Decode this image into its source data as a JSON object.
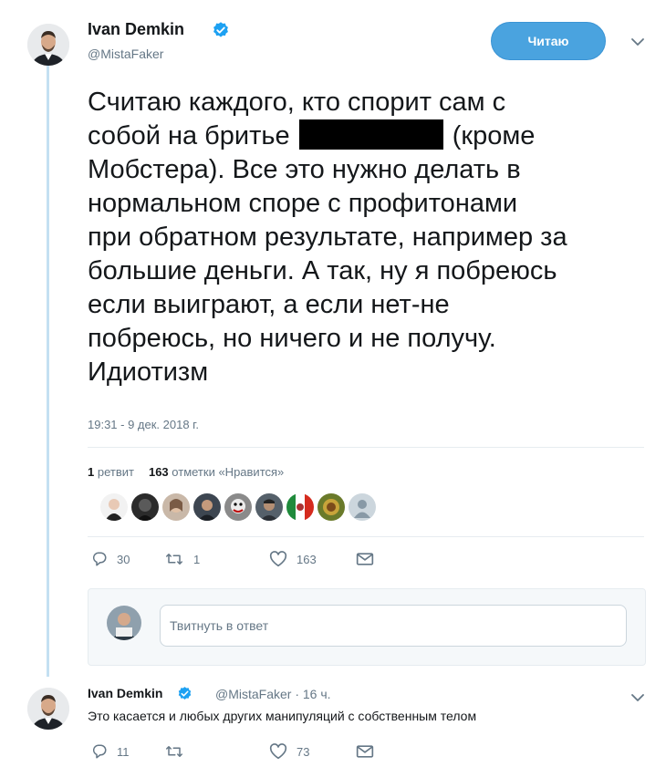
{
  "colors": {
    "accent": "#1da1f2",
    "follow_button": "#4aa3df",
    "thread_line": "#c4e0f2",
    "muted": "#657786"
  },
  "tweet": {
    "author_name": "Ivan Demkin",
    "author_handle": "@MistaFaker",
    "verified": true,
    "follow_label": "Читаю",
    "text_lines": [
      "Считаю каждого, кто спорит сам с",
      "собой на бритье",
      "(кроме",
      "Мобстера). Все это нужно делать в",
      "нормальном споре с профитонами",
      "при обратном результате, например за",
      "большие деньги. А так, ну я побреюсь",
      "если выиграют, а если нет-не",
      "побреюсь, но ничего и не получу.",
      "Идиотизм"
    ],
    "timestamp": "19:31 - 9 дек. 2018 г.",
    "retweets_count": "1",
    "retweets_label": "ретвит",
    "likes_count": "163",
    "likes_label": "отметки «Нравится»",
    "actions": {
      "replies": "30",
      "retweets": "1",
      "likes": "163"
    },
    "liker_avatars": [
      "liker-1",
      "liker-2",
      "liker-3",
      "liker-4",
      "liker-5",
      "liker-6",
      "liker-7",
      "liker-8",
      "liker-9"
    ]
  },
  "reply_box": {
    "placeholder": "Твитнуть в ответ"
  },
  "reply": {
    "author_name": "Ivan Demkin",
    "author_handle": "@MistaFaker",
    "time": "· 16 ч.",
    "text": "Это касается и любых других манипуляций с собственным телом",
    "actions": {
      "replies": "11",
      "retweets": "",
      "likes": "73"
    }
  },
  "icons": [
    "reply-icon",
    "retweet-icon",
    "like-icon",
    "message-icon",
    "verified-icon",
    "chevron-down-icon"
  ]
}
